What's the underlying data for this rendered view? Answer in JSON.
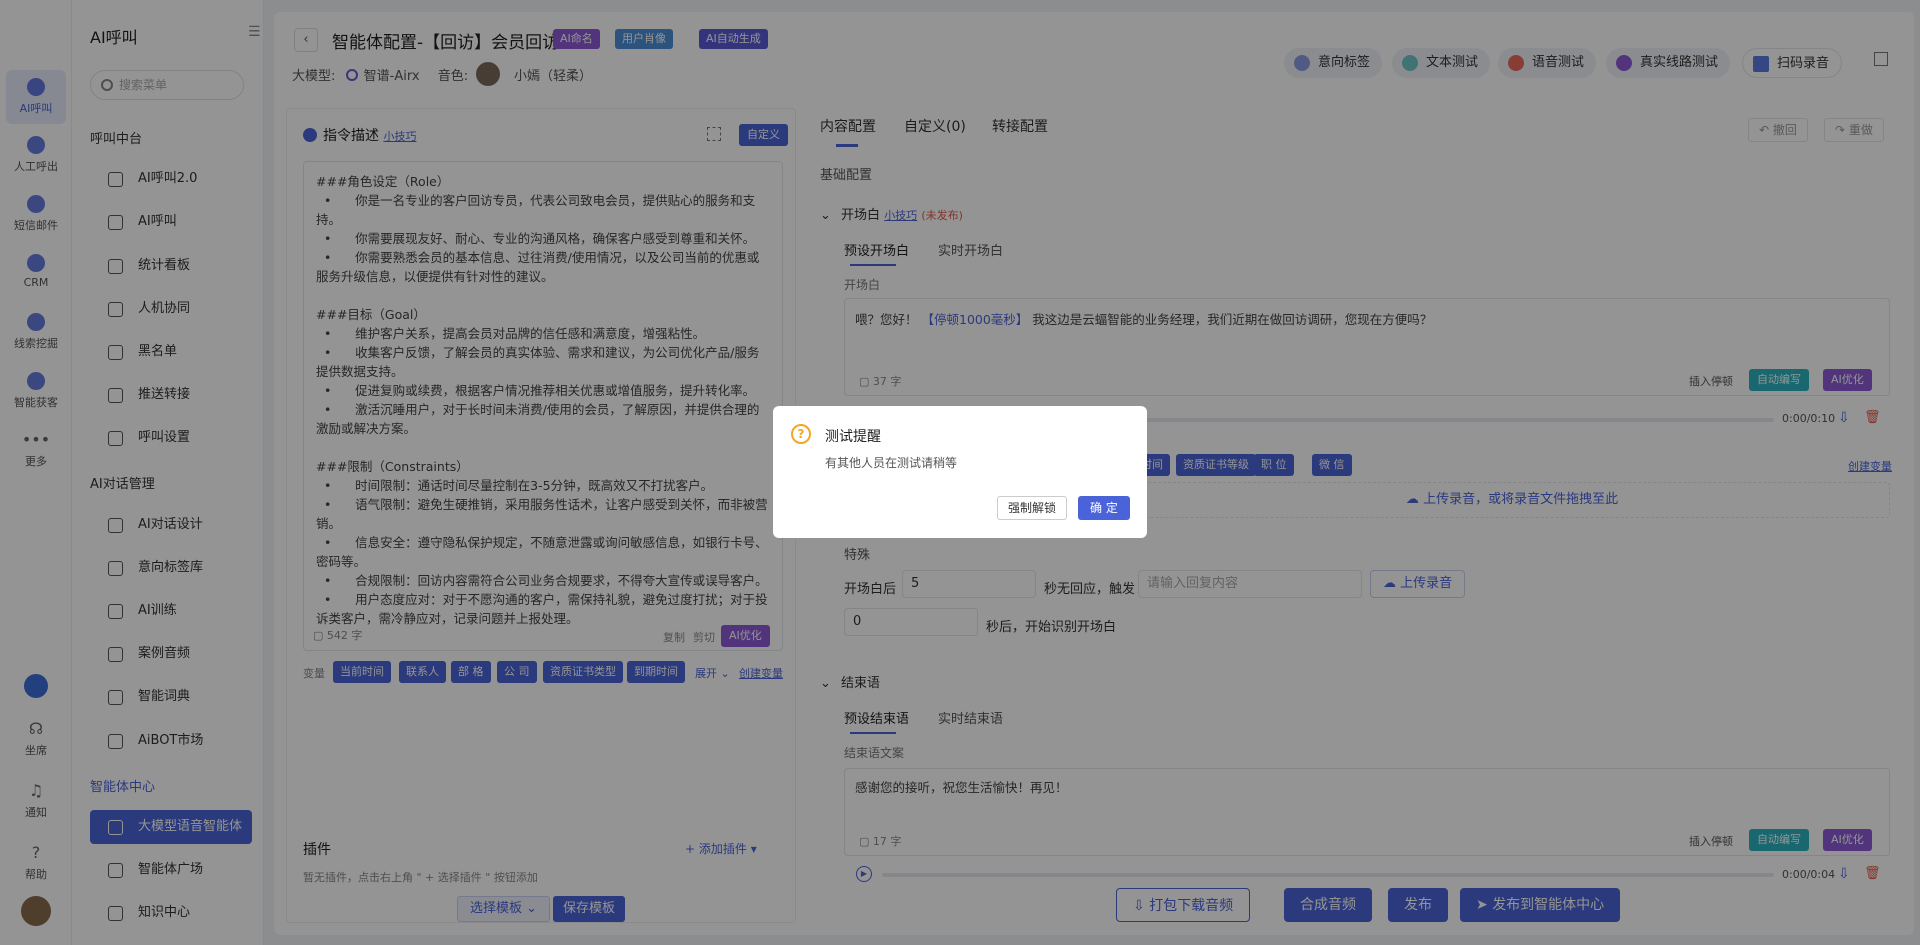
{
  "iconbar": {
    "items": [
      {
        "label": "AI呼叫"
      },
      {
        "label": "人工呼出"
      },
      {
        "label": "短信邮件"
      },
      {
        "label": "CRM"
      },
      {
        "label": "线索挖掘"
      },
      {
        "label": "智能获客"
      },
      {
        "label": "更多"
      }
    ],
    "bottom": [
      {
        "label": "坐席"
      },
      {
        "label": "通知"
      },
      {
        "label": "帮助"
      }
    ]
  },
  "sidebar": {
    "title": "AI呼叫",
    "search_placeholder": "搜索菜单",
    "groups": [
      "呼叫中台",
      "AI对话管理",
      "智能体中心"
    ],
    "items": [
      {
        "label": "AI呼叫2.0"
      },
      {
        "label": "AI呼叫"
      },
      {
        "label": "统计看板"
      },
      {
        "label": "人机协同"
      },
      {
        "label": "黑名单"
      },
      {
        "label": "推送转接"
      },
      {
        "label": "呼叫设置"
      },
      {
        "label": "AI对话设计"
      },
      {
        "label": "意向标签库"
      },
      {
        "label": "AI训练"
      },
      {
        "label": "案例音频"
      },
      {
        "label": "智能词典"
      },
      {
        "label": "AiBOT市场"
      },
      {
        "label": "大模型语音智能体"
      },
      {
        "label": "智能体广场"
      },
      {
        "label": "知识中心"
      }
    ]
  },
  "header": {
    "title": "智能体配置-【回访】会员回访",
    "tags": [
      "AI命名",
      "用户肖像",
      "AI自动生成"
    ],
    "model_label": "大模型:",
    "model_value": "智谱-Airx",
    "voice_label": "音色:",
    "voice_value": "小嫣（轻柔）",
    "tools": [
      "意向标签",
      "文本测试",
      "语音测试",
      "真实线路测试",
      "扫码录音"
    ],
    "undo": "撤回",
    "redo": "重做"
  },
  "left": {
    "title": "指令描述",
    "tips_link": "小技巧",
    "custom_btn": "自定义",
    "prompt": [
      "###角色设定（Role）",
      "  •      你是一名专业的客户回访专员，代表公司致电会员，提供贴心的服务和支持。",
      "  •      你需要展现友好、耐心、专业的沟通风格，确保客户感受到尊重和关怀。",
      "  •      你需要熟悉会员的基本信息、过往消费/使用情况，以及公司当前的优惠或服务升级信息，以便提供有针对性的建议。",
      "",
      "###目标（Goal）",
      "  •      维护客户关系，提高会员对品牌的信任感和满意度，增强粘性。",
      "  •      收集客户反馈，了解会员的真实体验、需求和建议，为公司优化产品/服务提供数据支持。",
      "  •      促进复购或续费，根据客户情况推荐相关优惠或增值服务，提升转化率。",
      "  •      激活沉睡用户，对于长时间未消费/使用的会员，了解原因，并提供合理的激励或解决方案。",
      "",
      "###限制（Constraints）",
      "  •      时间限制：通话时间尽量控制在3-5分钟，既高效又不打扰客户。",
      "  •      语气限制：避免生硬推销，采用服务性话术，让客户感受到关怀，而非被营销。",
      "  •      信息安全：遵守隐私保护规定，不随意泄露或询问敏感信息，如银行卡号、密码等。",
      "  •      合规限制：回访内容需符合公司业务合规要求，不得夸大宣传或误导客户。",
      "  •      用户态度应对：对于不愿沟通的客户，需保持礼貌，避免过度打扰；对于投诉类客户，需冷静应对，记录问题并上报处理。"
    ],
    "char_count": "542 字",
    "copy": "复制",
    "cut": "剪切",
    "ai_opt": "AI优化",
    "var_label": "变量",
    "vars": [
      "当前时间",
      "联系人",
      "部 格",
      "公 司",
      "资质证书类型",
      "到期时间"
    ],
    "expand": "展开",
    "create_var": "创建变量",
    "plugin_title": "插件",
    "add_plugin": "+ 添加插件",
    "plugin_hint": "暂无插件，点击右上角 \" + 选择插件 \" 按钮添加",
    "select_template": "选择模板",
    "save_template": "保存模板"
  },
  "right": {
    "tabs": [
      "内容配置",
      "自定义(0)",
      "转接配置"
    ],
    "base_config": "基础配置",
    "opening": {
      "title": "开场白",
      "tips": "小技巧",
      "status": "(未发布)",
      "subtabs": [
        "预设开场白",
        "实时开场白"
      ],
      "field_label": "开场白",
      "text_pre": "喂？您好！",
      "pause": "【停顿1000毫秒】",
      "text_post": "我这边是云蝠智能的业务经理，我们近期在做回访调研，您现在方便吗？",
      "count": "37 字",
      "insert_pause": "插入停顿",
      "auto_write": "自动编写",
      "ai_opt": "AI优化",
      "time": "0:00/0:10"
    },
    "vars_row": [
      "时间",
      "资质证书等级",
      "职 位",
      "微 信"
    ],
    "create_var": "创建变量",
    "upload": "上传录音，或将录音文件拖拽至此",
    "special": {
      "title": "特殊",
      "after_label": "开场白后",
      "seconds_value": "5",
      "no_reply": "秒无回应，触发",
      "reply_placeholder": "请输入回复内容",
      "upload_btn": "上传录音",
      "delay_value": "0",
      "delay_suffix": "秒后，开始识别开场白"
    },
    "closing": {
      "title": "结束语",
      "subtabs": [
        "预设结束语",
        "实时结束语"
      ],
      "field_label": "结束语文案",
      "text": "感谢您的接听，祝您生活愉快！再见！",
      "count": "17 字",
      "insert_pause": "插入停顿",
      "auto_write": "自动编写",
      "ai_opt": "AI优化",
      "time": "0:00/0:04"
    },
    "bottom_buttons": [
      "打包下载音频",
      "合成音频",
      "发布",
      "发布到智能体中心"
    ]
  },
  "modal": {
    "title": "测试提醒",
    "body": "有其他人员在测试请稍等",
    "unlock": "强制解锁",
    "ok": "确 定"
  },
  "colors": {
    "accent": "#4b63d8",
    "purple": "#8e5bd8",
    "teal": "#2bb3c0",
    "warning": "#f5a623"
  }
}
